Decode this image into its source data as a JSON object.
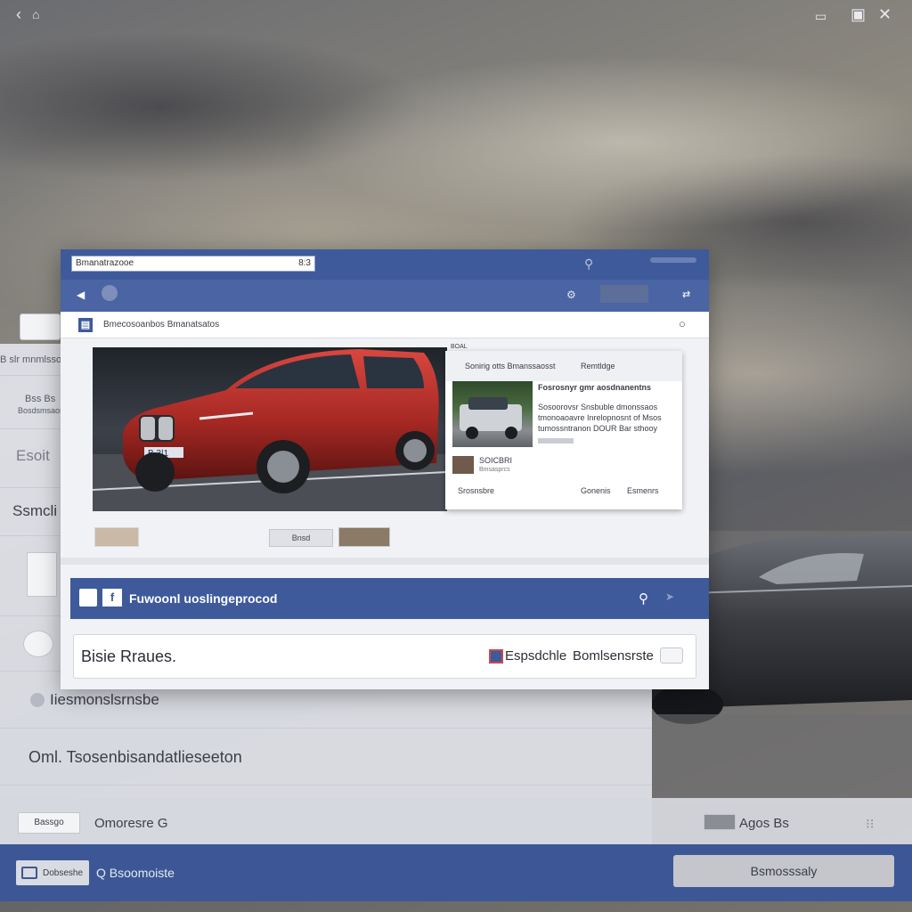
{
  "topbar": {
    "back_icon": "back-chevron-icon",
    "app_icon": "bird-icon",
    "minimize_icon": "minimize-icon",
    "window_icon": "window-icon",
    "close_icon": "close-icon"
  },
  "window": {
    "address": "Bmanatrazooe",
    "address_number": "8:3",
    "subbar_label": "Bmecosoanbos Bmanatsatos",
    "hero_plate": "B 3|1",
    "post": {
      "header_tag": "BOAL",
      "header": "Sonirig otts Bmanssaosst",
      "header_right": "Remtldge",
      "title_line": "Fosrosnyr gmr aosdnanentns",
      "body_lines": [
        "Sosoorovsr Snsbuble dmonssaos",
        "tmonoaoavre Inrelopnosnt of Msos",
        "tumossntranon DOUR Bar sthooy"
      ],
      "author": "SOICBRI",
      "author_sub": "Bmsasprcs",
      "footer_left": "Srosnsbre",
      "footer_mid": "Gonenis",
      "footer_right": "Esmenrs"
    },
    "chip_label": "Bnsd",
    "section_title": "Fuwoonl uoslingeprocod",
    "input_text": "Bisie Rraues.",
    "input_right_a": "Espsdchle",
    "input_right_b": "Bomlsensrste"
  },
  "background_page": {
    "row1_label": "B slr mnmlssoe",
    "row2_small_a": "Bss Bs",
    "row2_small_b": "Bosdsmsaos",
    "row3_label": "Esoit",
    "row4_label": "Ssmcli",
    "row7_label": "Iiesmonslsrnsbe",
    "row8_label": "Oml. Tsosenbisandatlieseeton",
    "strip_chip": "Bassgo",
    "strip_text": "Omoresre G",
    "strip_right": "Agos Bs",
    "bottom_chip": "Dobseshe",
    "bottom_text": "Q Bsoomoiste",
    "bottom_button": "Bsmosssaly"
  }
}
